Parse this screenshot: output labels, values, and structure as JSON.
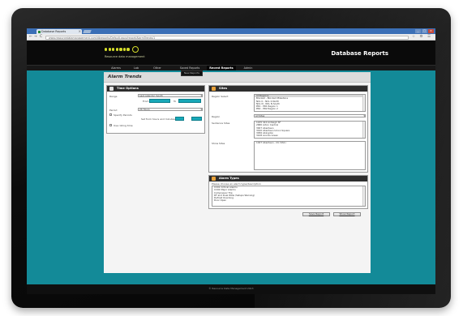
{
  "browser": {
    "tab_title": "Database Reports",
    "tab_close": "×",
    "url": "www.resourcedatamanagement.com/dbreports/Default.aspx/report/AlarmTrends/1",
    "back": "←",
    "forward": "→",
    "reload": "C",
    "tools": "☆ ⚙ ☰",
    "window_controls": [
      "_",
      "□",
      "×"
    ]
  },
  "app": {
    "logo_text": "Resource data management",
    "title": "Database Reports",
    "accent_color": "#d4dc2a",
    "teal_color": "#138a98"
  },
  "menu": {
    "items": [
      "Alarms",
      "Lab",
      "Other",
      "Saved Reports",
      "Recent Reports",
      "Admin"
    ],
    "submenu_item": "New Reports"
  },
  "page": {
    "title": "Alarm Trends"
  },
  "time_options": {
    "header": "Time Options",
    "labels": [
      "Range",
      "From",
      "To",
      "Period",
      "Specify Periods",
      "Set from hours and minutes",
      "Use rolling time",
      "Use selected tenancy only"
    ],
    "range_value": "Last calendar month",
    "period_value": "24 Hours"
  },
  "sites": {
    "header": "Sites",
    "labels": [
      "Region Select",
      "Region",
      "Sentence Sites",
      "Show Sites"
    ],
    "region_list": [
      "All Regions",
      "Blocked - Blocked Milestone",
      "NCL K - NCL K North",
      "NCL N - NCL N South",
      "PR1 - PR1 Region 1",
      "PR2 - PR2 Region 2"
    ],
    "region_dropdown": "All Sites",
    "site_list": [
      "1225 410 Ardleigh SF",
      "2680 Acton Central",
      "3007 Aberdeen",
      "3010 Aberdeen Union Square",
      "3056 Abingdon",
      "3108 Acocks Green"
    ],
    "show_sites_value": "1027 Aberdeen - CU (SS1)"
  },
  "alarm_types": {
    "header": "Alarm Types",
    "hint": "Please choose an alarm type/description",
    "list": [
      "CC01 Critical Alarms",
      "CC02 Major Alarms",
      "Compressor Trip",
      "DF and Dual Wide (Setups Warning)",
      "Defrost Overlong",
      "Door Open"
    ]
  },
  "actions": {
    "save_report": "Save Report",
    "show_report": "Show Report"
  },
  "footer": {
    "text": "© Resource Data Management 2013"
  }
}
